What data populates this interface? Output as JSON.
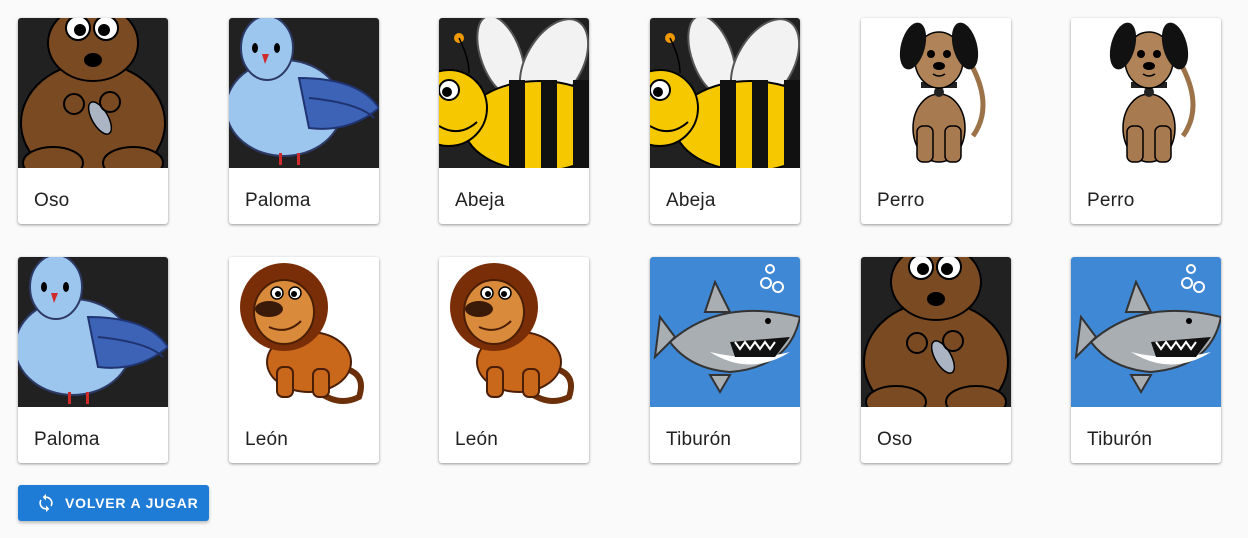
{
  "colors": {
    "accent": "#1e7bd6",
    "page_bg": "#fafafa",
    "dark_tile": "#212121",
    "shark_bg": "#3f88d6"
  },
  "cards": [
    {
      "animal": "bear",
      "label": "Oso"
    },
    {
      "animal": "dove",
      "label": "Paloma"
    },
    {
      "animal": "bee",
      "label": "Abeja"
    },
    {
      "animal": "bee",
      "label": "Abeja"
    },
    {
      "animal": "dog",
      "label": "Perro"
    },
    {
      "animal": "dog",
      "label": "Perro"
    },
    {
      "animal": "dove",
      "label": "Paloma"
    },
    {
      "animal": "lion",
      "label": "León"
    },
    {
      "animal": "lion",
      "label": "León"
    },
    {
      "animal": "shark",
      "label": "Tiburón"
    },
    {
      "animal": "bear",
      "label": "Oso"
    },
    {
      "animal": "shark",
      "label": "Tiburón"
    }
  ],
  "replay_button": {
    "label": "VOLVER A JUGAR",
    "icon": "refresh-icon"
  }
}
